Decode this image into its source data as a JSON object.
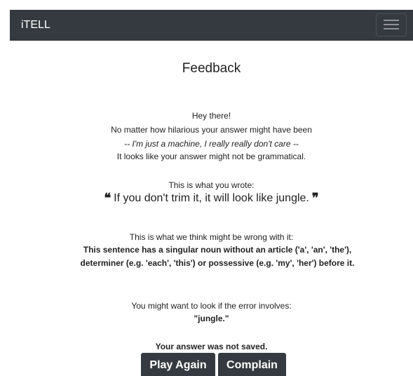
{
  "navbar": {
    "brand": "iTELL",
    "menu_icon": "hamburger-menu-icon"
  },
  "feedback": {
    "title": "Feedback",
    "greeting": "Hey there!",
    "line2": "No matter how hilarious your answer might have been",
    "line3": "-- I'm just a machine, I really really don't care --",
    "line4": "It looks like your answer might not be grammatical.",
    "wrote_label": "This is what you wrote:",
    "open_quote": "❝",
    "user_answer": "If you don't trim it, it will look like jungle.",
    "close_quote": "❞",
    "wrong_label": "This is what we think might be wrong with it:",
    "error_explanation": "This sentence has a singular noun without an article ('a', 'an', 'the'), determiner (e.g. 'each', 'this') or possessive (e.g. 'my', 'her') before it.",
    "involves_label": "You might want to look if the error involves:",
    "involved_word": "\"jungle.\"",
    "saved_status": "Your answer was not saved."
  },
  "buttons": {
    "play_again": "Play Again",
    "complain": "Complain"
  }
}
